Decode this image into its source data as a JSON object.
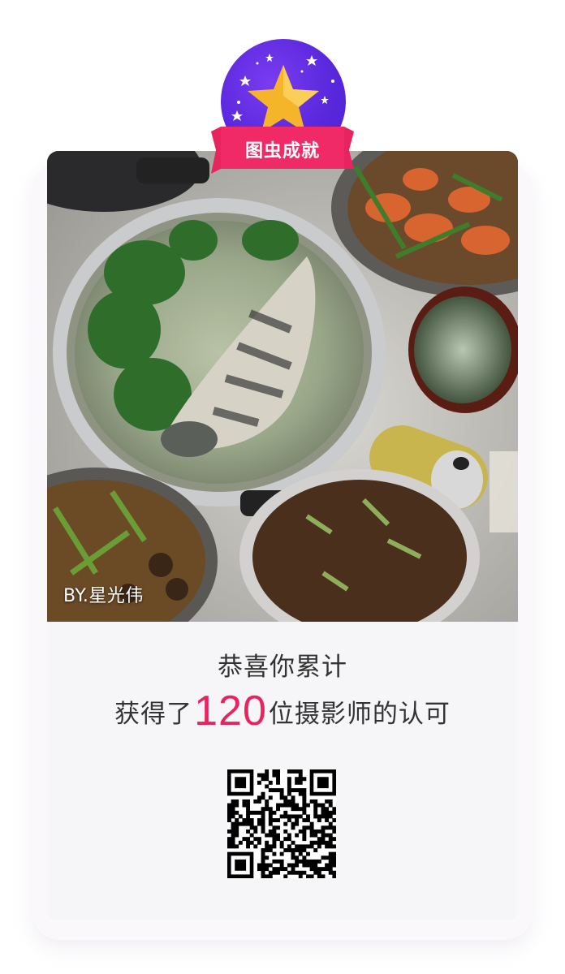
{
  "badge": {
    "title": "图虫成就",
    "icon": "star-icon",
    "colors": {
      "circle": "#5a28dd",
      "ribbon": "#e8245f",
      "star": "#f5b52a"
    }
  },
  "photo": {
    "credit": "BY.星光伟"
  },
  "message": {
    "line1": "恭喜你累计",
    "line2_prefix": "获得了",
    "count": "120",
    "line2_suffix": "位摄影师的认可",
    "accent_color": "#e8245f"
  },
  "qr": {
    "icon": "qr-code"
  }
}
